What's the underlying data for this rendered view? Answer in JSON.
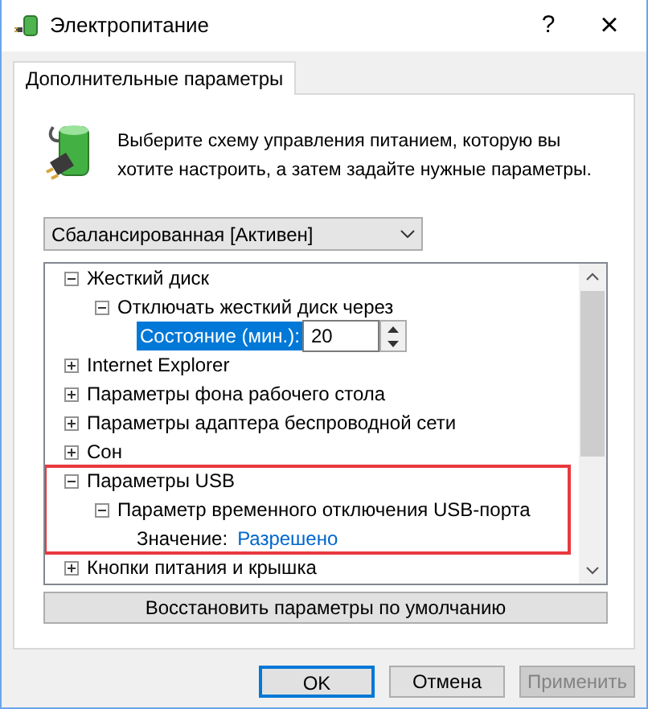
{
  "window": {
    "title": "Электропитание",
    "help": "?",
    "close": "×"
  },
  "tabs": [
    {
      "label": "Дополнительные параметры",
      "selected": true
    }
  ],
  "intro": "Выберите схему управления питанием, которую вы хотите настроить, а затем задайте нужные параметры.",
  "plan_dropdown": {
    "value": "Сбалансированная [Активен]"
  },
  "tree": [
    {
      "kind": "group",
      "label": "Жесткий диск",
      "expanded": true,
      "highlighted": false,
      "children": [
        {
          "kind": "group",
          "label": "Отключать жесткий диск через",
          "expanded": true,
          "highlighted": false,
          "children": [
            {
              "kind": "spin",
              "label": "Состояние (мин.):",
              "value": "20",
              "selected": true
            }
          ]
        }
      ]
    },
    {
      "kind": "group",
      "label": "Internet Explorer",
      "expanded": false,
      "highlighted": false
    },
    {
      "kind": "group",
      "label": "Параметры фона рабочего стола",
      "expanded": false,
      "highlighted": false
    },
    {
      "kind": "group",
      "label": "Параметры адаптера беспроводной сети",
      "expanded": false,
      "highlighted": false
    },
    {
      "kind": "group",
      "label": "Сон",
      "expanded": false,
      "highlighted": false
    },
    {
      "kind": "group",
      "label": "Параметры USB",
      "expanded": true,
      "highlighted": true,
      "children": [
        {
          "kind": "group",
          "label": "Параметр временного отключения USB-порта",
          "expanded": true,
          "highlighted": false,
          "children": [
            {
              "kind": "value",
              "label": "Значение:",
              "value": "Разрешено",
              "selected": false
            }
          ]
        }
      ]
    },
    {
      "kind": "group",
      "label": "Кнопки питания и крышка",
      "expanded": false,
      "highlighted": false
    }
  ],
  "restore_button": "Восстановить параметры по умолчанию",
  "buttons": [
    {
      "label": "OK",
      "default": true,
      "disabled": false
    },
    {
      "label": "Отмена",
      "default": false,
      "disabled": false
    },
    {
      "label": "Применить",
      "default": false,
      "disabled": true
    }
  ]
}
